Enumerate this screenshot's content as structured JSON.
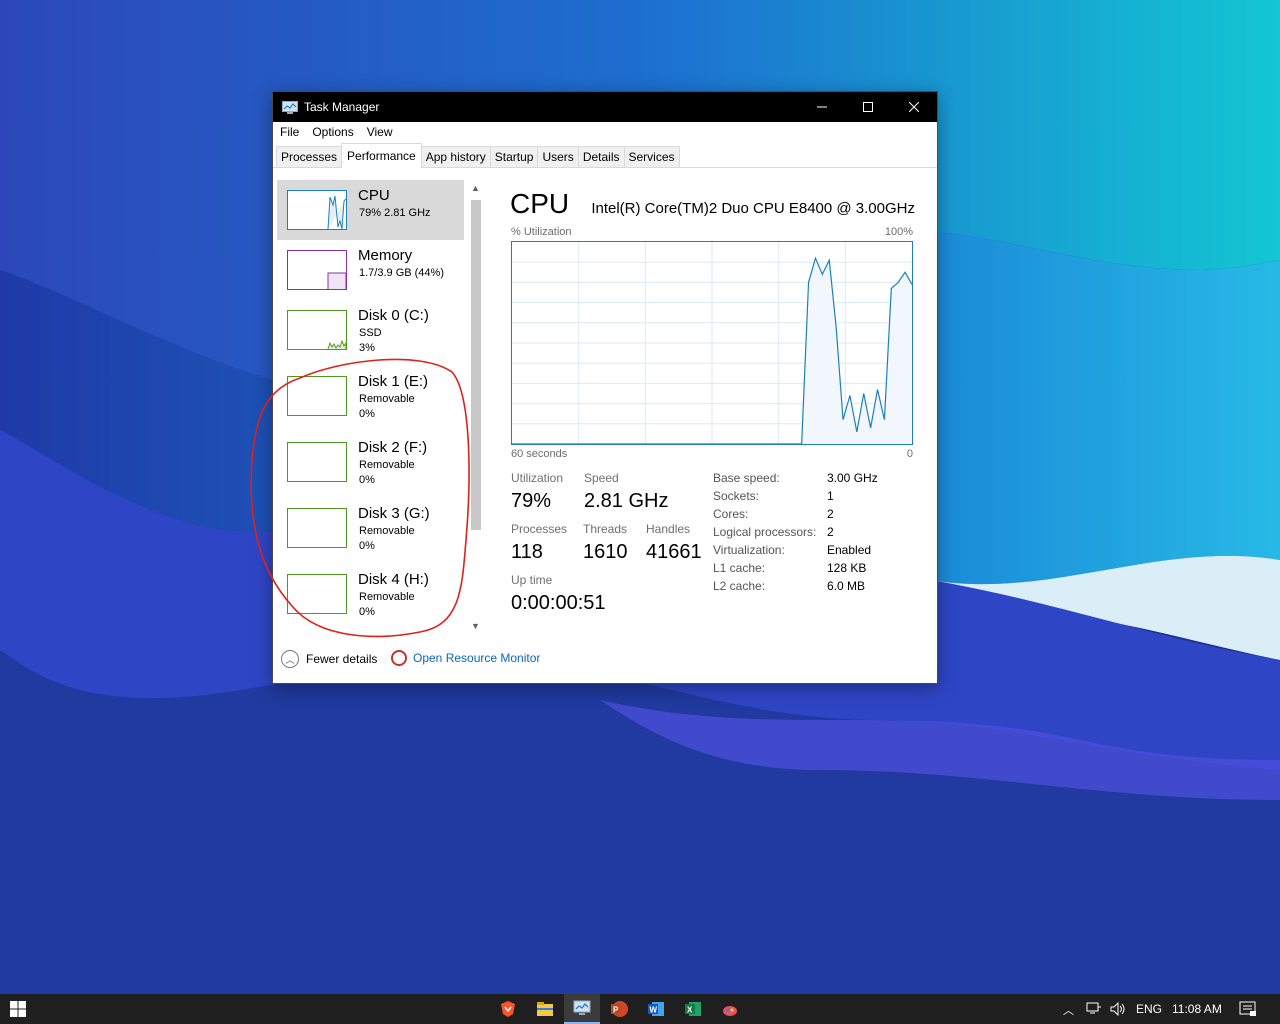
{
  "window": {
    "title": "Task Manager",
    "menu": [
      "File",
      "Options",
      "View"
    ],
    "tabs": [
      "Processes",
      "Performance",
      "App history",
      "Startup",
      "Users",
      "Details",
      "Services"
    ],
    "active_tab": "Performance"
  },
  "sidebar": {
    "items": [
      {
        "name": "CPU",
        "sub1": "79%  2.81 GHz",
        "sub2": "",
        "color": "#1c80c0"
      },
      {
        "name": "Memory",
        "sub1": "1.7/3.9 GB (44%)",
        "sub2": "",
        "color": "#8b2fa8"
      },
      {
        "name": "Disk 0 (C:)",
        "sub1": "SSD",
        "sub2": "3%",
        "color": "#4f9a1c"
      },
      {
        "name": "Disk 1 (E:)",
        "sub1": "Removable",
        "sub2": "0%",
        "color": "#4f9a1c"
      },
      {
        "name": "Disk 2 (F:)",
        "sub1": "Removable",
        "sub2": "0%",
        "color": "#4f9a1c"
      },
      {
        "name": "Disk 3 (G:)",
        "sub1": "Removable",
        "sub2": "0%",
        "color": "#4f9a1c"
      },
      {
        "name": "Disk 4 (H:)",
        "sub1": "Removable",
        "sub2": "0%",
        "color": "#4f9a1c"
      }
    ]
  },
  "cpu": {
    "title": "CPU",
    "model": "Intel(R) Core(TM)2 Duo CPU E8400 @ 3.00GHz",
    "graph_label": "% Utilization",
    "graph_max": "100%",
    "graph_time": "60 seconds",
    "graph_min": "0",
    "utilization_history": [
      0,
      0,
      0,
      0,
      0,
      0,
      0,
      0,
      0,
      0,
      0,
      0,
      0,
      0,
      0,
      0,
      0,
      0,
      0,
      0,
      0,
      0,
      0,
      0,
      0,
      0,
      0,
      0,
      0,
      0,
      0,
      0,
      0,
      0,
      0,
      0,
      0,
      0,
      0,
      0,
      0,
      0,
      0,
      80,
      92,
      84,
      91,
      58,
      12,
      24,
      6,
      25,
      8,
      27,
      12,
      77,
      80,
      85,
      79
    ],
    "stats": {
      "utilization_label": "Utilization",
      "utilization": "79%",
      "speed_label": "Speed",
      "speed": "2.81 GHz",
      "processes_label": "Processes",
      "processes": "118",
      "threads_label": "Threads",
      "threads": "1610",
      "handles_label": "Handles",
      "handles": "41661",
      "uptime_label": "Up time",
      "uptime": "0:00:00:51"
    },
    "details": [
      {
        "label": "Base speed:",
        "value": "3.00 GHz"
      },
      {
        "label": "Sockets:",
        "value": "1"
      },
      {
        "label": "Cores:",
        "value": "2"
      },
      {
        "label": "Logical processors:",
        "value": "2"
      },
      {
        "label": "Virtualization:",
        "value": "Enabled"
      },
      {
        "label": "L1 cache:",
        "value": "128 KB"
      },
      {
        "label": "L2 cache:",
        "value": "6.0 MB"
      }
    ]
  },
  "footer": {
    "fewer_details": "Fewer details",
    "resource_monitor": "Open Resource Monitor"
  },
  "taskbar": {
    "pinned": [
      "brave-icon",
      "file-explorer-icon",
      "task-manager-icon",
      "powerpoint-icon",
      "word-icon",
      "excel-icon",
      "paint-icon"
    ],
    "language": "ENG",
    "time": "11:08 AM"
  }
}
